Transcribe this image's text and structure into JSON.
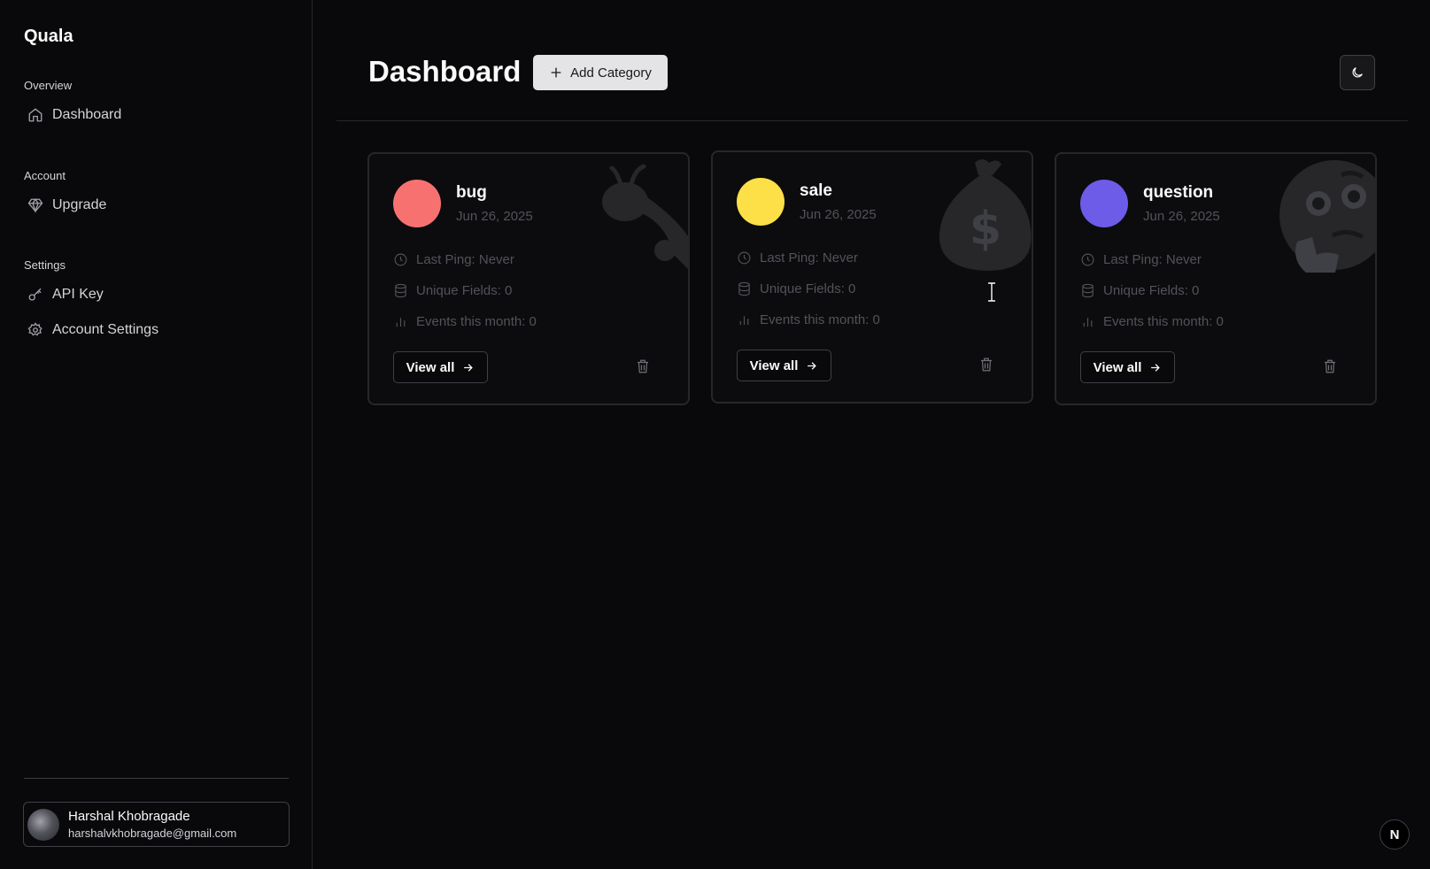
{
  "sidebar": {
    "brand": "Quala",
    "sections": [
      {
        "heading": "Overview",
        "items": [
          {
            "label": "Dashboard",
            "icon": "home-icon"
          }
        ]
      },
      {
        "heading": "Account",
        "items": [
          {
            "label": "Upgrade",
            "icon": "gem-icon"
          }
        ]
      },
      {
        "heading": "Settings",
        "items": [
          {
            "label": "API Key",
            "icon": "key-icon"
          },
          {
            "label": "Account Settings",
            "icon": "gear-icon"
          }
        ]
      }
    ],
    "user": {
      "name": "Harshal Khobragade",
      "email": "harshalvkhobragade@gmail.com"
    }
  },
  "header": {
    "title": "Dashboard",
    "add_category_label": "Add Category",
    "theme_toggle_icon": "moon-icon"
  },
  "cards": [
    {
      "name": "bug",
      "date": "Jun 26, 2025",
      "color": "#f87171",
      "emoji_icon": "bug-icon",
      "last_ping_label": "Last Ping: Never",
      "unique_fields_label": "Unique Fields: 0",
      "events_label": "Events this month: 0",
      "view_all_label": "View all"
    },
    {
      "name": "sale",
      "date": "Jun 26, 2025",
      "color": "#fde047",
      "emoji_icon": "money-bag-icon",
      "last_ping_label": "Last Ping: Never",
      "unique_fields_label": "Unique Fields: 0",
      "events_label": "Events this month: 0",
      "view_all_label": "View all"
    },
    {
      "name": "question",
      "date": "Jun 26, 2025",
      "color": "#6c5ce7",
      "emoji_icon": "thinking-face-icon",
      "last_ping_label": "Last Ping: Never",
      "unique_fields_label": "Unique Fields: 0",
      "events_label": "Events this month: 0",
      "view_all_label": "View all"
    }
  ],
  "badge": {
    "label": "N"
  },
  "colors": {
    "background": "#09090b",
    "border": "#27272a",
    "button_light": "#e4e4e7"
  }
}
